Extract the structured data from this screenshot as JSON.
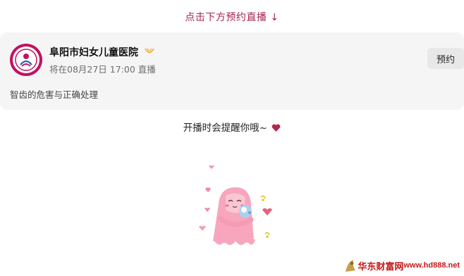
{
  "headline": {
    "text": "点击下方预约直播 ↓"
  },
  "card": {
    "org_name": "阜阳市妇女儿童医院",
    "schedule": "将在08月27日 17:00 直播",
    "reserve_label": "预约",
    "topic": "智齿的危害与正确处理",
    "avatar_icon": "hospital-logo-icon",
    "verified_icon": "verified-badge-icon"
  },
  "reminder": {
    "text": "开播时会提醒你哦~",
    "heart_icon": "heart-icon"
  },
  "sticker": {
    "icon": "cartoon-hugging-sticker"
  },
  "watermark": {
    "name": "华东财富网",
    "url": "www.hd888.net"
  },
  "colors": {
    "headline": "#a8234a",
    "card_bg": "#f5f5f5",
    "button_bg": "#e8e8e8",
    "heart": "#b0284a",
    "logo": "#c01262",
    "badge": "#f0a830",
    "watermark": "#c41a1a"
  }
}
